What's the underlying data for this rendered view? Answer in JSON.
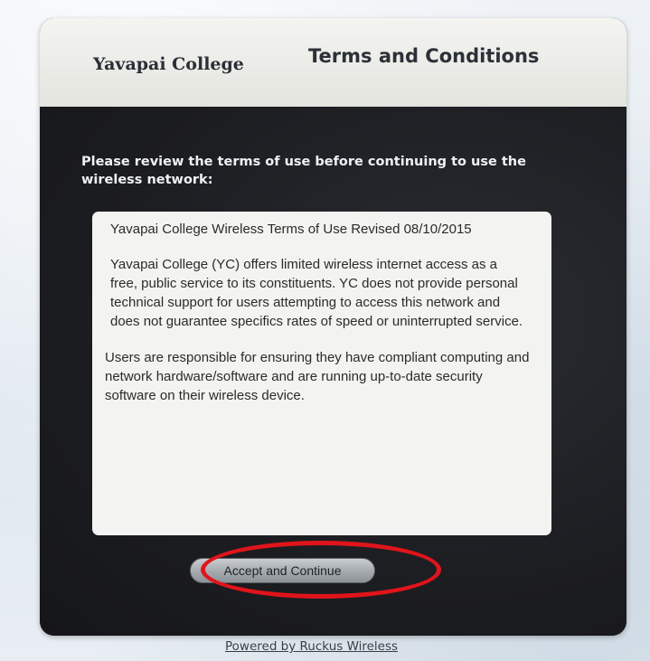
{
  "header": {
    "brand": "Yavapai College",
    "title": "Terms and Conditions"
  },
  "intro": "Please review the terms of use before continuing to use the wireless network:",
  "terms": {
    "title": "Yavapai College Wireless Terms of Use  Revised 08/10/2015",
    "paragraphs": [
      "Yavapai College (YC) offers limited wireless internet access as a free, public service to its constituents.  YC does not provide personal technical support for users attempting to access this network and does not guarantee specifics rates of speed or uninterrupted service.",
      "Users are responsible for ensuring they have compliant computing and network hardware/software and are running up-to-date security software on their wireless device."
    ]
  },
  "accept_button": {
    "label": "Accept and Continue"
  },
  "footer": {
    "link": "Powered by Ruckus Wireless"
  },
  "colors": {
    "highlight": "#e0141b",
    "panel_dark": "#1d1f23",
    "header_bg": "#ecece8"
  }
}
